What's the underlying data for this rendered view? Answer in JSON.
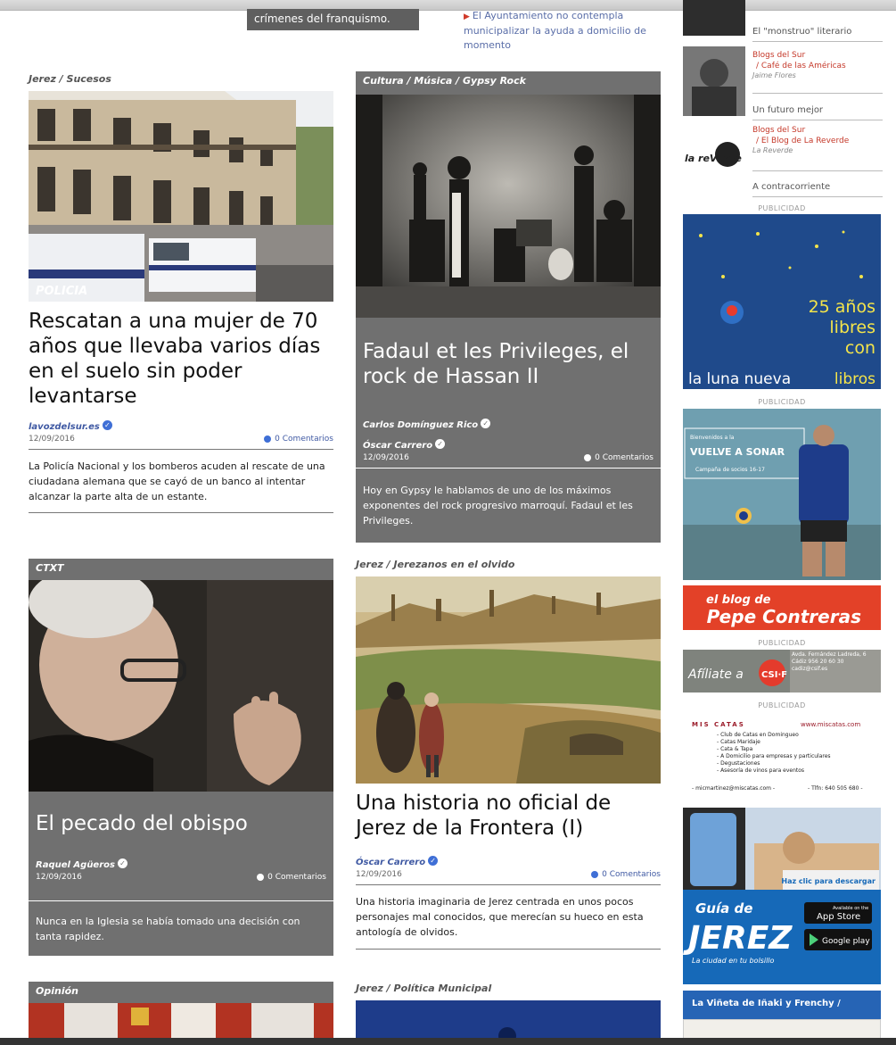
{
  "top": {
    "dark_teaser": "crímenes del franquismo.",
    "link_teaser": "El Ayuntamiento no contempla municipalizar la ayuda a domicilio de momento"
  },
  "articles": [
    {
      "section": "Jerez / Sucesos",
      "title": "Rescatan a una mujer de 70 años que llevaba varios días en el suelo sin poder levantarse",
      "authors": [
        "lavozdelsur.es"
      ],
      "date": "12/09/2016",
      "comments": "0 Comentarios",
      "excerpt": "La Policía Nacional y los bomberos acuden al rescate de una ciudadana alemana que se cayó de un banco al intentar alcanzar la parte alta de un estante.",
      "image_label": "POLICIA"
    },
    {
      "section": "Cultura / Música / Gypsy Rock",
      "title": "Fadaul et les Privileges, el rock de Hassan II",
      "authors": [
        "Carlos Domínguez Rico",
        "Óscar Carrero"
      ],
      "date": "12/09/2016",
      "comments": "0 Comentarios",
      "excerpt": "Hoy en Gypsy le hablamos de uno de los máximos exponentes del rock progresivo marroquí. Fadaul et les Privileges."
    },
    {
      "section": "CTXT",
      "title": "El pecado del obispo",
      "authors": [
        "Raquel Agüeros"
      ],
      "date": "12/09/2016",
      "comments": "0 Comentarios",
      "excerpt": "Nunca en la Iglesia se había tomado una decisión con tanta rapidez."
    },
    {
      "section": "Jerez / Jerezanos en el olvido",
      "title": "Una historia no oficial de Jerez de la Frontera (I)",
      "authors": [
        "Óscar Carrero"
      ],
      "date": "12/09/2016",
      "comments": "0 Comentarios",
      "excerpt": "Una historia imaginaria de Jerez centrada en unos pocos personajes mal conocidos, que merecían su hueco en esta antología de olvidos."
    },
    {
      "section": "Opinión"
    },
    {
      "section": "Jerez / Política Municipal"
    }
  ],
  "sidebar": {
    "item1_title": "El \"monstruo\" literario",
    "item2_blog": "Blogs del Sur",
    "item2_sub": "/ Café de las Américas",
    "item2_author": "Jaime Flores",
    "item3_title": "Un futuro mejor",
    "item3_blog": "Blogs del Sur",
    "item3_sub": "/ El Blog de La Reverde",
    "item3_author": "La Reverde",
    "item3_logo": "la reVerde",
    "item4_title": "A contracorriente",
    "publicidad": "PUBLICIDAD",
    "ad_luna": {
      "line1": "25 años",
      "line2": "libres",
      "line3": "con",
      "brand1": "la luna nueva",
      "brand2": "libros"
    },
    "ad_sonar": {
      "kicker": "Bienvenidos a la",
      "title": "VUELVE A SONAR",
      "sub": "Campaña de socios 16-17"
    },
    "ad_pepe": {
      "line1": "el blog de",
      "line2": "Pepe Contreras"
    },
    "ad_csif": {
      "text": "Afíliate a",
      "brand": "CSI·F",
      "addr": "Avda. Fernández Ladreda, 6 Cádiz 956 20 60 30 cadiz@csif.es"
    },
    "ad_catas": {
      "brand": "MIS CATAS",
      "url": "www.miscatas.com",
      "items": [
        "- Club de Catas en Domingueo",
        "- Catas Maridaje",
        "- Cata & Tapa",
        "- A Domicilio para empresas y particulares",
        "- Degustaciones",
        "- Asesoría de vinos para eventos"
      ],
      "email": "- micmartinez@miscatas.com -",
      "tel": "- Tlfn: 640 505 680 -"
    },
    "ad_guia": {
      "cta": "Haz clic para descargar",
      "title": "Guía de",
      "big": "JEREZ",
      "tagline": "La ciudad en tu bolsillo",
      "appstore": "App Store",
      "appstore_pre": "Available on the",
      "gplay": "Google play"
    },
    "vineta": "La Viñeta de Iñaki y Frenchy /"
  }
}
